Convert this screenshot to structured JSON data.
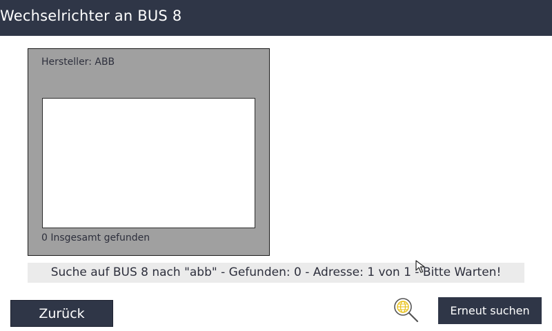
{
  "header": {
    "title": "Wechselrichter an BUS 8"
  },
  "panel": {
    "manufacturer_label": "Hersteller: ABB",
    "found_count_text": "0 Insgesamt gefunden"
  },
  "status": {
    "text": "Suche auf BUS 8 nach \"abb\" - Gefunden: 0 - Adresse: 1 von 1 - Bitte Warten!"
  },
  "buttons": {
    "back_label": "Zurück",
    "retry_label": "Erneut suchen"
  },
  "icons": {
    "search": "globe-magnifier-icon",
    "cursor": "mouse-pointer-icon"
  },
  "colors": {
    "header_bg": "#2f3647",
    "panel_bg": "#a0a0a0",
    "status_bg": "#ebebeb",
    "icon_accent": "#e8c21a"
  }
}
